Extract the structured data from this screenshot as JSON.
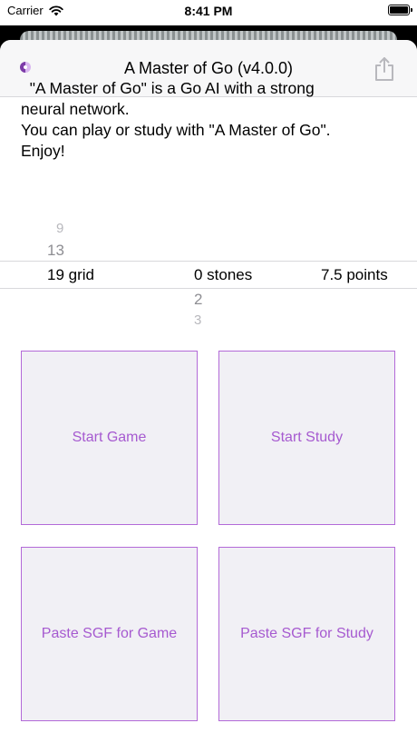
{
  "status_bar": {
    "carrier": "Carrier",
    "time": "8:41 PM"
  },
  "nav": {
    "title": "A Master of Go (v4.0.0)",
    "app_icon": "yin-yang-icon",
    "share_icon": "share-icon"
  },
  "intro": {
    "lines": [
      "  \"A Master of Go\" is a Go AI with a strong",
      "neural network.",
      "You can play or study with \"A Master of Go\".",
      "Enjoy!"
    ]
  },
  "picker": {
    "grid": {
      "above": [
        "9",
        "13"
      ],
      "selected": "19 grid"
    },
    "stones": {
      "selected": "0 stones",
      "below": [
        "2",
        "3"
      ]
    },
    "komi": {
      "selected": "7.5 points"
    }
  },
  "buttons": {
    "start_game": "Start Game",
    "start_study": "Start Study",
    "paste_game": "Paste SGF for Game",
    "paste_study": "Paste SGF for Study"
  },
  "colors": {
    "accent": "#a65ad0",
    "tile_border": "#b36ad8",
    "tile_bg": "#f1f0f5"
  }
}
